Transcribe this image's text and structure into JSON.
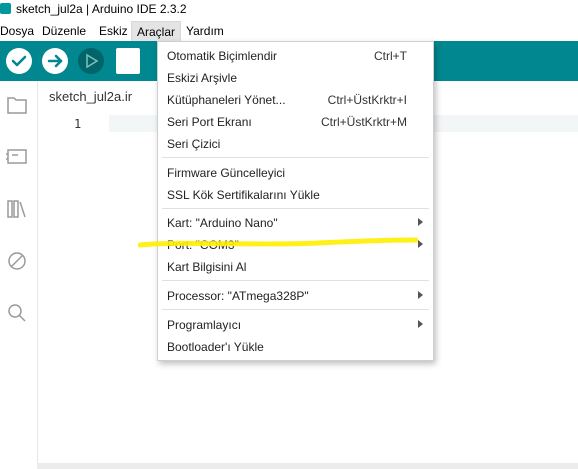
{
  "window": {
    "title": "sketch_jul2a | Arduino IDE 2.3.2",
    "app_icon": "arduino-icon"
  },
  "menubar": {
    "items": [
      "Dosya",
      "Düzenle",
      "Eskiz",
      "Araçlar",
      "Yardım"
    ],
    "active": "Araçlar"
  },
  "toolbar": {
    "buttons": [
      "verify-icon",
      "upload-icon",
      "debug-icon"
    ]
  },
  "sidebar": {
    "icons": [
      "folder-icon",
      "board-icon",
      "library-icon",
      "debug-icon",
      "search-icon"
    ]
  },
  "editor": {
    "tab_label": "sketch_jul2a.ir",
    "line_number": "1"
  },
  "dropdown": {
    "items": [
      {
        "label": "Otomatik Biçimlendir",
        "shortcut": "Ctrl+T"
      },
      {
        "label": "Eskizi Arşivle",
        "shortcut": ""
      },
      {
        "label": "Kütüphaneleri Yönet...",
        "shortcut": "Ctrl+ÜstKrktr+I"
      },
      {
        "label": "Seri Port Ekranı",
        "shortcut": "Ctrl+ÜstKrktr+M"
      },
      {
        "label": "Seri Çizici",
        "shortcut": ""
      },
      {
        "label": "Firmware Güncelleyici",
        "shortcut": ""
      },
      {
        "label": "SSL Kök Sertifikalarını Yükle",
        "shortcut": ""
      },
      {
        "label": "Kart: \"Arduino Nano\"",
        "shortcut": ""
      },
      {
        "label": "Port: \"COM3\"",
        "shortcut": ""
      },
      {
        "label": "Kart Bilgisini Al",
        "shortcut": ""
      },
      {
        "label": "Processor: \"ATmega328P\"",
        "shortcut": ""
      },
      {
        "label": "Programlayıcı",
        "shortcut": ""
      },
      {
        "label": "Bootloader'ı Yükle",
        "shortcut": ""
      }
    ]
  },
  "colors": {
    "toolbar": "#00878f",
    "highlight": "#ffee00",
    "accent_icon": "#00979d"
  }
}
